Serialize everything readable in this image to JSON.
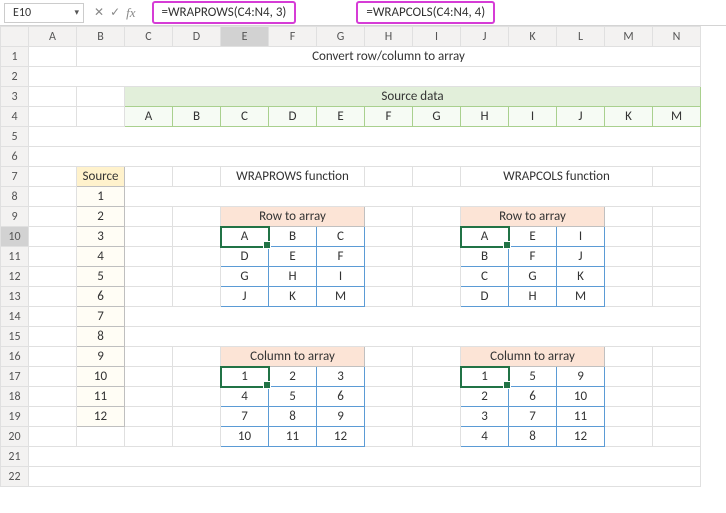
{
  "nameBox": "E10",
  "formulas": {
    "left": "=WRAPROWS(C4:N4, 3)",
    "right": "=WRAPCOLS(C4:N4, 4)"
  },
  "columns": [
    "A",
    "B",
    "C",
    "D",
    "E",
    "F",
    "G",
    "H",
    "I",
    "J",
    "K",
    "L",
    "M",
    "N"
  ],
  "rows": [
    "1",
    "2",
    "3",
    "4",
    "5",
    "6",
    "7",
    "8",
    "9",
    "10",
    "11",
    "12",
    "13",
    "14",
    "15",
    "16",
    "17",
    "18",
    "19",
    "20",
    "21",
    "22"
  ],
  "titles": {
    "main": "Convert row/column to array",
    "sourceData": "Source data",
    "wraprows": "WRAPROWS function",
    "wrapcols": "WRAPCOLS function",
    "source": "Source",
    "rowToArray": "Row to array",
    "colToArray": "Column to array"
  },
  "sourceRow": [
    "A",
    "B",
    "C",
    "D",
    "E",
    "F",
    "G",
    "H",
    "I",
    "J",
    "K",
    "M"
  ],
  "sourceCol": [
    "1",
    "2",
    "3",
    "4",
    "5",
    "6",
    "7",
    "8",
    "9",
    "10",
    "11",
    "12"
  ],
  "wraprows_row": [
    [
      "A",
      "B",
      "C"
    ],
    [
      "D",
      "E",
      "F"
    ],
    [
      "G",
      "H",
      "I"
    ],
    [
      "J",
      "K",
      "M"
    ]
  ],
  "wrapcols_row": [
    [
      "A",
      "E",
      "I"
    ],
    [
      "B",
      "F",
      "J"
    ],
    [
      "C",
      "G",
      "K"
    ],
    [
      "D",
      "H",
      "M"
    ]
  ],
  "wraprows_col": [
    [
      "1",
      "2",
      "3"
    ],
    [
      "4",
      "5",
      "6"
    ],
    [
      "7",
      "8",
      "9"
    ],
    [
      "10",
      "11",
      "12"
    ]
  ],
  "wrapcols_col": [
    [
      "1",
      "5",
      "9"
    ],
    [
      "2",
      "6",
      "10"
    ],
    [
      "3",
      "7",
      "11"
    ],
    [
      "4",
      "8",
      "12"
    ]
  ],
  "icons": {
    "check": "✓",
    "x": "✕"
  }
}
